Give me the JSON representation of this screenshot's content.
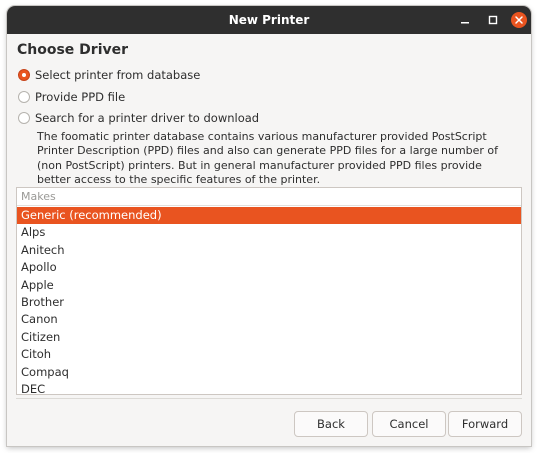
{
  "window": {
    "title": "New Printer",
    "controls": {
      "minimize": "minimize-icon",
      "maximize": "maximize-icon",
      "close": "close-icon"
    },
    "accent": "#e95420"
  },
  "page": {
    "heading": "Choose Driver",
    "options": [
      {
        "label": "Select printer from database",
        "checked": true
      },
      {
        "label": "Provide PPD file",
        "checked": false
      },
      {
        "label": "Search for a printer driver to download",
        "checked": false
      }
    ],
    "description": "The foomatic printer database contains various manufacturer provided PostScript Printer Description (PPD) files and also can generate PPD files for a large number of (non PostScript) printers. But in general manufacturer provided PPD files provide better access to the specific features of the printer."
  },
  "makes": {
    "header": "Makes",
    "selected_index": 0,
    "items": [
      "Generic (recommended)",
      "Alps",
      "Anitech",
      "Apollo",
      "Apple",
      "Brother",
      "Canon",
      "Citizen",
      "Citoh",
      "Compaq",
      "DEC"
    ]
  },
  "buttons": {
    "back": "Back",
    "cancel": "Cancel",
    "forward": "Forward"
  }
}
